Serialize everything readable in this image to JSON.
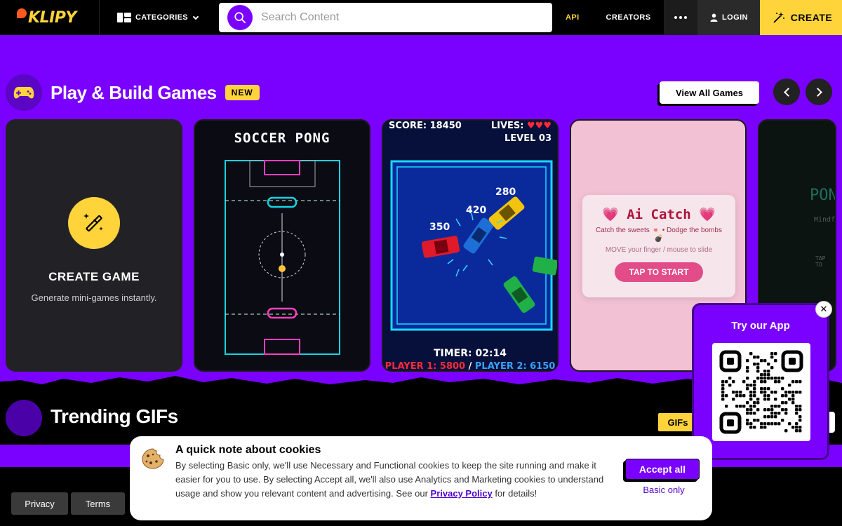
{
  "header": {
    "logo_text": "KLIPY",
    "categories_label": "CATEGORIES",
    "search_placeholder": "Search Content",
    "nav": {
      "api": "API",
      "creators": "CREATORS",
      "login": "LOGIN",
      "create": "CREATE"
    }
  },
  "games": {
    "title": "Play & Build Games",
    "badge": "NEW",
    "view_all": "View All Games",
    "create_card": {
      "title": "CREATE GAME",
      "subtitle": "Generate mini-games instantly."
    },
    "soccer_pong": {
      "title": "SOCCER PONG"
    },
    "cars": {
      "score": "SCORE: 18450",
      "lives_label": "LIVES:",
      "level": "LEVEL 03",
      "labels": [
        "350",
        "420",
        "280"
      ],
      "timer": "TIMER: 02:14",
      "player1": "PLAYER 1: 5800",
      "separator": "/",
      "player2": "PLAYER 2: 6150"
    },
    "ai_catch": {
      "title": "💗 Ai Catch 💗",
      "line1": "Catch the sweets 🍬 • Dodge the bombs 💣",
      "line2": "MOVE your finger / mouse to slide",
      "button": "TAP TO START"
    },
    "pong": {
      "title": "PON",
      "subtitle": "Mindf",
      "tap": "TAP TO"
    }
  },
  "trending": {
    "title": "Trending GIFs",
    "tab": "GIFs"
  },
  "qr_popup": {
    "title": "Try our App"
  },
  "cookie": {
    "title": "A quick note about cookies",
    "text": "By selecting Basic only, we'll use Necessary and Functional cookies to keep the site running and make it easier for you to use. By selecting Accept all, we'll also use Analytics and Marketing cookies to understand usage and show you relevant content and advertising. See our ",
    "link": "Privacy Policy",
    "text_end": " for details!",
    "accept": "Accept all",
    "basic": "Basic only"
  },
  "footer": {
    "privacy": "Privacy",
    "terms": "Terms"
  },
  "colors": {
    "brand": "#7a00ff",
    "accent": "#ffd43b",
    "dark": "#000000"
  },
  "icons": [
    "search-icon",
    "categories-icon",
    "chevron-down-icon",
    "more-icon",
    "user-icon",
    "sparkle-icon",
    "gamepad-icon",
    "chevron-left-icon",
    "chevron-right-icon",
    "magic-wand-icon",
    "close-icon",
    "cookie-icon",
    "qr-code"
  ]
}
